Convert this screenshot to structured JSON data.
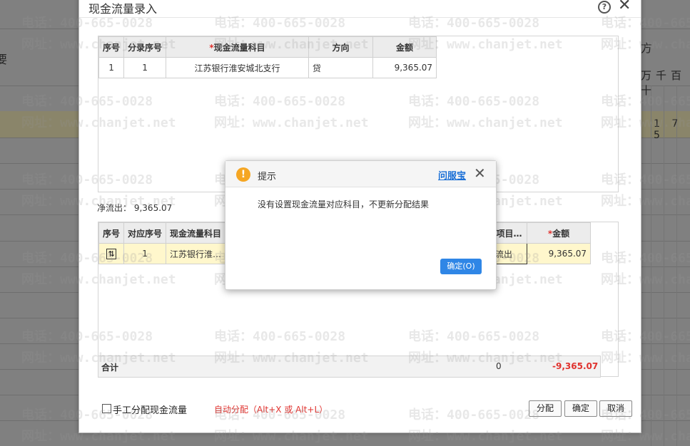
{
  "dialog": {
    "title": "现金流量录入",
    "upper_table": {
      "headers": [
        "序号",
        "分录序号",
        "现金流量科目",
        "方向",
        "金额"
      ],
      "rows": [
        {
          "seq": "1",
          "entry_seq": "1",
          "subject": "江苏银行淮安城北支行",
          "direction": "贷",
          "amount": "9,365.07"
        }
      ]
    },
    "net_outflow_label": "净流出：",
    "net_outflow_value": "9,365.07",
    "lower_table": {
      "headers": [
        "序号",
        "对应序号",
        "现金流量科目",
        "项目…",
        "金额"
      ],
      "rows": [
        {
          "seq_icon": "split-icon",
          "corr_seq": "1",
          "subject": "江苏银行淮…",
          "item": "流出",
          "amount": "9,365.07"
        }
      ]
    },
    "total": {
      "label": "合计",
      "zero": "0",
      "amount": "-9,365.07"
    },
    "manual_checkbox_label": "手工分配现金流量",
    "auto_allocate_text": "自动分配（Alt+X 或 Alt+L）",
    "buttons": {
      "allocate": "分配",
      "confirm": "确定",
      "cancel": "取消"
    }
  },
  "prompt": {
    "title": "提示",
    "help_link": "问服宝",
    "message": "没有设置现金流量对应科目，不更新分配结果",
    "ok_button": "确定(O)"
  },
  "background": {
    "right_header": "方",
    "right_digits": "万千百十",
    "right_values": "1 7 5",
    "left_char": "要"
  },
  "watermark": {
    "phone": "电话：400-665-0028",
    "site": "网址：www.chanjet.net"
  },
  "colors": {
    "accent": "#2f86e6",
    "warning": "#f5a623",
    "negative": "#e0332f",
    "row_highlight": "#fff7cc"
  }
}
